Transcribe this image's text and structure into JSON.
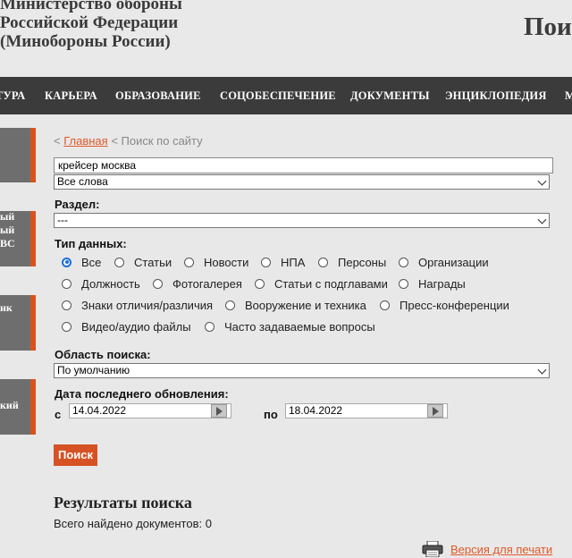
{
  "header": {
    "ministry_lines": [
      "Министерство обороны",
      "Российской Федерации",
      "(Минобороны России)"
    ],
    "page_heading_fragment": "Пои"
  },
  "nav": {
    "items": [
      "ТУРА",
      "КАРЬЕРА",
      "ОБРАЗОВАНИЕ",
      "СОЦОБЕСПЕЧЕНИЕ",
      "ДОКУМЕНТЫ",
      "ЭНЦИКЛОПЕДИЯ",
      "М"
    ]
  },
  "sidebar": {
    "blocks": [
      {
        "lines": []
      },
      {
        "lines": [
          "ый",
          "ый",
          "ВС"
        ]
      },
      {
        "lines": [
          "нк"
        ]
      },
      {
        "lines": [
          "кий"
        ]
      }
    ]
  },
  "breadcrumb": {
    "prefix": "<",
    "home_link": "Главная",
    "separator": "<",
    "current": "Поиск по сайту"
  },
  "search": {
    "query_value": "крейсер москва",
    "match_mode_selected": "Все слова",
    "section_label": "Раздел:",
    "section_selected": "---",
    "data_type_label": "Тип данных:",
    "data_types": [
      {
        "label": "Все",
        "checked": true
      },
      {
        "label": "Статьи",
        "checked": false
      },
      {
        "label": "Новости",
        "checked": false
      },
      {
        "label": "НПА",
        "checked": false
      },
      {
        "label": "Персоны",
        "checked": false
      },
      {
        "label": "Организации",
        "checked": false
      },
      {
        "label": "Должность",
        "checked": false
      },
      {
        "label": "Фотогалерея",
        "checked": false
      },
      {
        "label": "Статьи с подглавами",
        "checked": false
      },
      {
        "label": "Награды",
        "checked": false
      },
      {
        "label": "Знаки отличия/различия",
        "checked": false
      },
      {
        "label": "Вооружение и техника",
        "checked": false
      },
      {
        "label": "Пресс-конференции",
        "checked": false
      },
      {
        "label": "Видео/аудио файлы",
        "checked": false
      },
      {
        "label": "Часто задаваемые вопросы",
        "checked": false
      }
    ],
    "scope_label": "Область поиска:",
    "scope_selected": "По умолчанию",
    "date_label": "Дата последнего обновления:",
    "date_from_label": "с",
    "date_from_value": "14.04.2022",
    "date_to_label": "по",
    "date_to_value": "18.04.2022",
    "submit_label": "Поиск"
  },
  "results": {
    "title": "Результаты поиска",
    "count_text": "Всего найдено документов: 0"
  },
  "footer": {
    "print_link": "Версия для печати"
  },
  "colors": {
    "accent": "#d65224",
    "link": "#e05a28",
    "nav_bg": "#3b3b3b",
    "page_bg": "#e8e8e8",
    "radio_checked": "#1a6fd6"
  }
}
